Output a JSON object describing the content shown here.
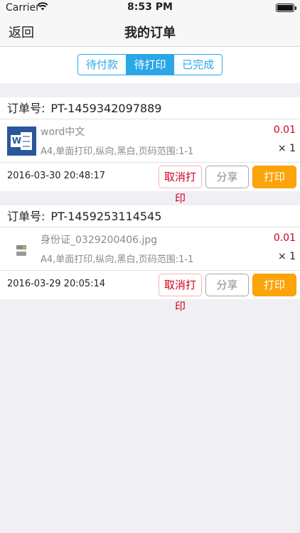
{
  "status_bar": {
    "carrier": "Carrier",
    "time": "8:53 PM"
  },
  "nav": {
    "back_label": "返回",
    "title": "我的订单"
  },
  "tabs": [
    {
      "label": "待付款",
      "active": false
    },
    {
      "label": "待打印",
      "active": true
    },
    {
      "label": "已完成",
      "active": false
    }
  ],
  "order_number_label": "订单号:",
  "orders": [
    {
      "order_number": "PT-1459342097889",
      "item": {
        "icon": "word-document-icon",
        "name": "word中文",
        "price": "0.01",
        "spec": "A4,单面打印,纵向,黑白,页码范围:1-1",
        "quantity": "× 1"
      },
      "date": "2016-03-30 20:48:17",
      "buttons": {
        "cancel": "取消打印",
        "share": "分享",
        "print": "打印"
      }
    },
    {
      "order_number": "PT-1459253114545",
      "item": {
        "icon": "image-thumbnail-icon",
        "name": "身份证_0329200406.jpg",
        "price": "0.01",
        "spec": "A4,单面打印,纵向,黑白,页码范围:1-1",
        "quantity": "× 1"
      },
      "date": "2016-03-29 20:05:14",
      "buttons": {
        "cancel": "取消打印",
        "share": "分享",
        "print": "打印"
      }
    }
  ],
  "colors": {
    "accent": "#2aa7e6",
    "price": "#d0021b",
    "print_button": "#fda40b",
    "background": "#efeff4"
  }
}
